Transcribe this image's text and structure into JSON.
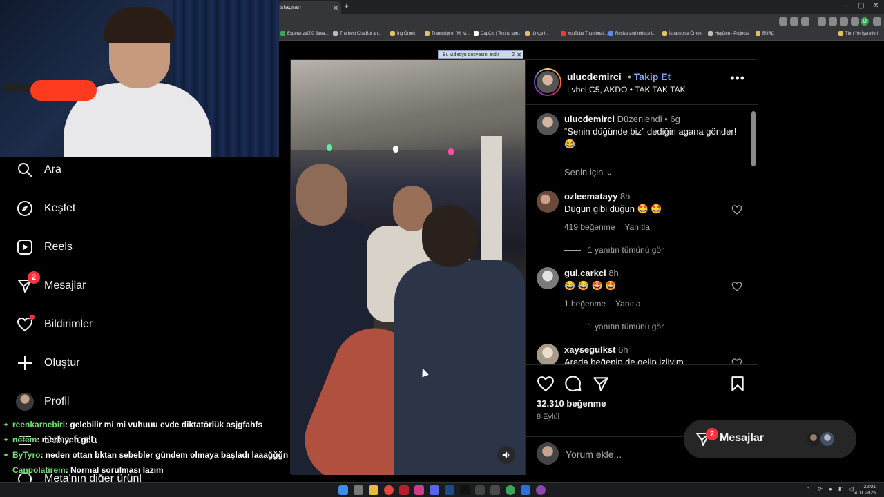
{
  "browser": {
    "tab_title": "stagram",
    "bookmarks": [
      {
        "label": "Esperanza000 Strea...",
        "color": "#3aa655"
      },
      {
        "label": "The best ChatBot an...",
        "color": "#bbbbbb"
      },
      {
        "label": "İng Örnek",
        "color": "#e0c060"
      },
      {
        "label": "Transcript of \"Mi M...",
        "color": "#e0c060"
      },
      {
        "label": "CapCut | Text to spe...",
        "color": "#ffffff"
      },
      {
        "label": "türkçe h.",
        "color": "#e0c060"
      },
      {
        "label": "YouTube Thumbnail...",
        "color": "#ff3333"
      },
      {
        "label": "Resize and reduce i...",
        "color": "#5b8def"
      },
      {
        "label": "İspanyolca Örnek",
        "color": "#e0c060"
      },
      {
        "label": "HeyGen - Projects",
        "color": "#bbbbbb"
      },
      {
        "label": "BURÇ",
        "color": "#e0c060"
      },
      {
        "label": "Tüm Yer İşaretleri",
        "color": "#e0c060"
      }
    ],
    "notice_text": "Bu videoyu dosyasını indir",
    "notice_badge": "2"
  },
  "nav": {
    "items": [
      {
        "label": "Ara",
        "icon": "search-icon"
      },
      {
        "label": "Keşfet",
        "icon": "compass-icon"
      },
      {
        "label": "Reels",
        "icon": "reels-icon"
      },
      {
        "label": "Mesajlar",
        "icon": "messenger-icon",
        "badge": "2"
      },
      {
        "label": "Bildirimler",
        "icon": "heart-icon"
      },
      {
        "label": "Oluştur",
        "icon": "plus-icon"
      },
      {
        "label": "Profil",
        "icon": "avatar"
      },
      {
        "label": "Daha fazla",
        "icon": "menu-icon"
      },
      {
        "label": "Meta'nın diğer ürünl",
        "icon": "meta-icon"
      }
    ]
  },
  "chat": [
    {
      "user": "reenkarnebiri",
      "msg": ": gelebilir mi mi vuhuuu evde diktatörlük asjgfahfs",
      "star": true
    },
    {
      "user": "nefem",
      "msg": ": merh yeh gel",
      "star": true
    },
    {
      "user": "ByTyro",
      "msg": ": neden ottan bktan sebebler gündem olmaya başladı laaağğğn",
      "star": true
    },
    {
      "user": "Canpolatirem",
      "msg": ": Normal sorulması lazım",
      "star": false
    }
  ],
  "post": {
    "username": "ulucdemirci",
    "separator": "•",
    "follow": "Takip Et",
    "location": "Lvbel C5, AKDO • TAK TAK TAK",
    "caption": {
      "user": "ulucdemirci",
      "edited": "Düzenlendi",
      "time": "6g",
      "text": "“Senin düğünde biz” dediğin agana gönder! 😂"
    },
    "for_you": "Senin için",
    "comments": [
      {
        "user": "ozleematayy",
        "time": "8h",
        "text": "Düğün gibi düğün 🤩 🤩",
        "likes": "419 beğenme",
        "reply": "Yanıtla",
        "replies": "1 yanıtın tümünü gör"
      },
      {
        "user": "gul.carkci",
        "time": "8h",
        "text": "😂 😂 🤩 🤩",
        "likes": "1 beğenme",
        "reply": "Yanıtla",
        "replies": "1 yanıtın tümünü gör"
      },
      {
        "user": "xaysegulkst",
        "time": "6h",
        "text": "Arada beğenip de gelip izliyim"
      }
    ],
    "like_count": "32.310 beğenme",
    "date": "8 Eylül",
    "add_comment_placeholder": "Yorum ekle..."
  },
  "messages_pill": {
    "label": "Mesajlar",
    "badge": "2"
  },
  "taskbar": {
    "time": "22:01",
    "date": "4.11.2025"
  }
}
